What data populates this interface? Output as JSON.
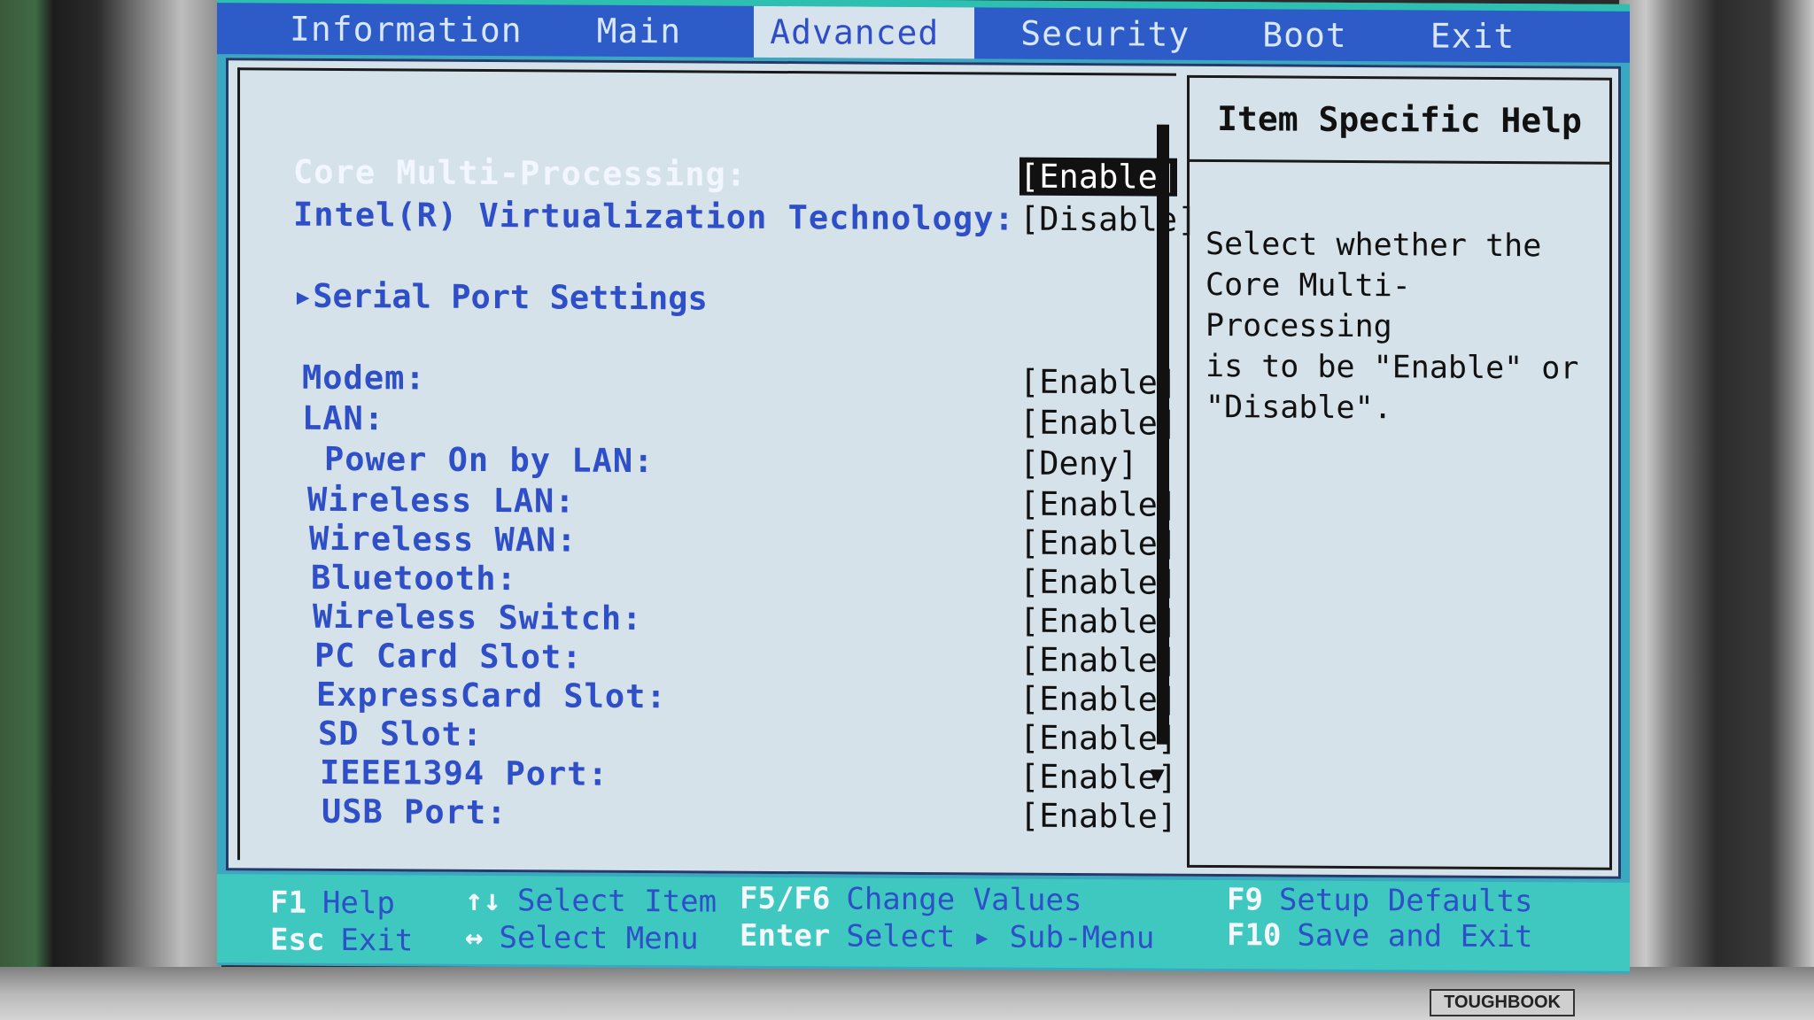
{
  "menu": {
    "tabs": [
      {
        "label": "Information"
      },
      {
        "label": "Main"
      },
      {
        "label": "Advanced"
      },
      {
        "label": "Security"
      },
      {
        "label": "Boot"
      },
      {
        "label": "Exit"
      }
    ],
    "active_tab": "Advanced"
  },
  "settings": {
    "core_multi_processing": {
      "label": "Core Multi-Processing:",
      "value": "[Enable]"
    },
    "virtualization": {
      "label": "Intel(R) Virtualization Technology:",
      "value": "[Disable]"
    },
    "serial_port": {
      "label": "Serial Port Settings"
    },
    "modem": {
      "label": "Modem:",
      "value": "[Enable]"
    },
    "lan": {
      "label": "LAN:",
      "value": "[Enable]"
    },
    "power_on_lan": {
      "label": "Power On by LAN:",
      "value": "[Deny]"
    },
    "wireless_lan": {
      "label": "Wireless LAN:",
      "value": "[Enable]"
    },
    "wireless_wan": {
      "label": "Wireless WAN:",
      "value": "[Enable]"
    },
    "bluetooth": {
      "label": "Bluetooth:",
      "value": "[Enable]"
    },
    "wireless_switch": {
      "label": "Wireless Switch:",
      "value": "[Enable]"
    },
    "pc_card_slot": {
      "label": "PC Card Slot:",
      "value": "[Enable]"
    },
    "expresscard_slot": {
      "label": "ExpressCard Slot:",
      "value": "[Enable]"
    },
    "sd_slot": {
      "label": "SD Slot:",
      "value": "[Enable]"
    },
    "ieee1394_port": {
      "label": "IEEE1394 Port:",
      "value": "[Enable]"
    },
    "usb_port": {
      "label": "USB Port:",
      "value": "[Enable]"
    }
  },
  "help": {
    "title": "Item Specific Help",
    "text": "Select whether the\nCore Multi-Processing\nis to be \"Enable\" or\n\"Disable\"."
  },
  "footer": {
    "f1": {
      "key": "F1",
      "label": "Help"
    },
    "esc": {
      "key": "Esc",
      "label": "Exit"
    },
    "updown": {
      "key": "↑↓",
      "label": "Select Item"
    },
    "leftright": {
      "key": "↔",
      "label": "Select Menu"
    },
    "f5f6": {
      "key": "F5/F6",
      "label": "Change Values"
    },
    "enter": {
      "key": "Enter",
      "label": "Select ▸ Sub-Menu"
    },
    "f9": {
      "key": "F9",
      "label": "Setup Defaults"
    },
    "f10": {
      "key": "F10",
      "label": "Save and Exit"
    }
  },
  "brand": "TOUGHBOOK",
  "colors": {
    "menubar": "#2d5cc8",
    "panel": "#d6e2ea",
    "label": "#2e4fc7",
    "footer": "#3fc8c0"
  }
}
